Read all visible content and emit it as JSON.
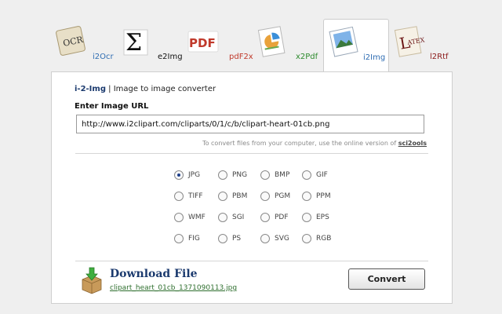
{
  "tabs": [
    {
      "label": "i2Ocr",
      "icon": "ocr-icon",
      "active": false,
      "color": "#2f6db3"
    },
    {
      "label": "e2Img",
      "icon": "sigma-icon",
      "active": false,
      "color": "#111111"
    },
    {
      "label": "pdF2x",
      "icon": "pdf-icon",
      "active": false,
      "color": "#c0392b"
    },
    {
      "label": "x2Pdf",
      "icon": "chart-doc-icon",
      "active": false,
      "color": "#2e8b2e"
    },
    {
      "label": "i2Img",
      "icon": "image-doc-icon",
      "active": true,
      "color": "#2f6db3"
    },
    {
      "label": "l2Rtf",
      "icon": "latex-icon",
      "active": false,
      "color": "#8b1a1a"
    }
  ],
  "header": {
    "app_name": "i-2-Img",
    "separator": " | ",
    "subtitle": "Image to image converter"
  },
  "url": {
    "label": "Enter Image URL",
    "value": "http://www.i2clipart.com/cliparts/0/1/c/b/clipart-heart-01cb.png"
  },
  "note": {
    "text": "To convert files from your computer, use the online version of ",
    "link": "sci2ools"
  },
  "formats": [
    "JPG",
    "PNG",
    "BMP",
    "GIF",
    "TIFF",
    "PBM",
    "PGM",
    "PPM",
    "WMF",
    "SGI",
    "PDF",
    "EPS",
    "FIG",
    "PS",
    "SVG",
    "RGB"
  ],
  "selected_format": "JPG",
  "download": {
    "title": "Download File",
    "filename": "clipart_heart_01cb_1371090113.jpg"
  },
  "convert_label": "Convert"
}
